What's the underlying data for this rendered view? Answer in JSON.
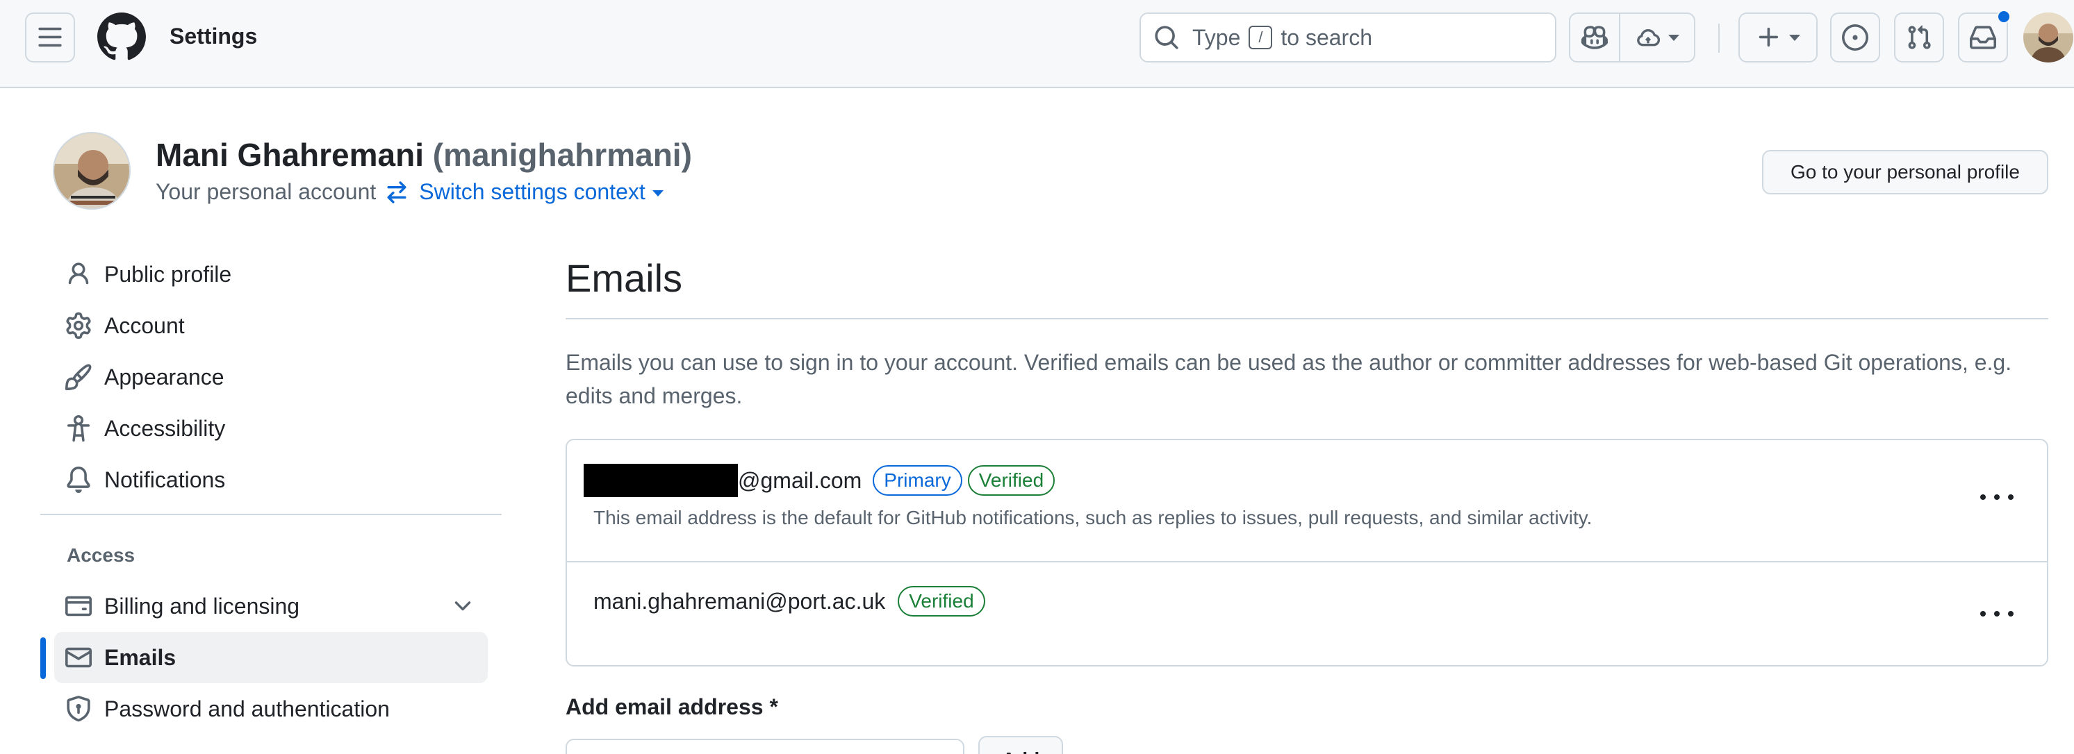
{
  "header": {
    "title": "Settings",
    "search": {
      "prefix": "Type",
      "key": "/",
      "suffix": "to search"
    },
    "icons": [
      "hamburger-menu-icon",
      "github-logo-icon",
      "search-icon",
      "copilot-icon",
      "cloud-icon",
      "plus-icon",
      "issue-icon",
      "pull-request-icon",
      "inbox-icon"
    ],
    "accent": "#0969da"
  },
  "profile": {
    "name": "Mani Ghahremani",
    "login": "(manighahrmani)",
    "account_type": "Your personal account",
    "switch_label": "Switch settings context",
    "goto_button": "Go to your personal profile"
  },
  "sidebar": {
    "items": [
      {
        "label": "Public profile",
        "icon": "person-icon"
      },
      {
        "label": "Account",
        "icon": "gear-icon"
      },
      {
        "label": "Appearance",
        "icon": "paintbrush-icon"
      },
      {
        "label": "Accessibility",
        "icon": "accessibility-icon"
      },
      {
        "label": "Notifications",
        "icon": "bell-icon"
      }
    ],
    "access_heading": "Access",
    "access_items": [
      {
        "label": "Billing and licensing",
        "icon": "credit-card-icon",
        "expandable": true
      },
      {
        "label": "Emails",
        "icon": "mail-icon",
        "active": true
      },
      {
        "label": "Password and authentication",
        "icon": "shield-lock-icon"
      }
    ]
  },
  "main": {
    "title": "Emails",
    "description": "Emails you can use to sign in to your account. Verified emails can be used as the author or committer addresses for web-based Git operations, e.g. edits and merges.",
    "emails": [
      {
        "address_suffix": "@gmail.com",
        "redacted": true,
        "badges": [
          "Primary",
          "Verified"
        ],
        "note": "This email address is the default for GitHub notifications, such as replies to issues, pull requests, and similar activity."
      },
      {
        "address": "mani.ghahremani@port.ac.uk",
        "badges": [
          "Verified"
        ]
      }
    ],
    "add_label": "Add email address *",
    "add_button": "Add"
  }
}
